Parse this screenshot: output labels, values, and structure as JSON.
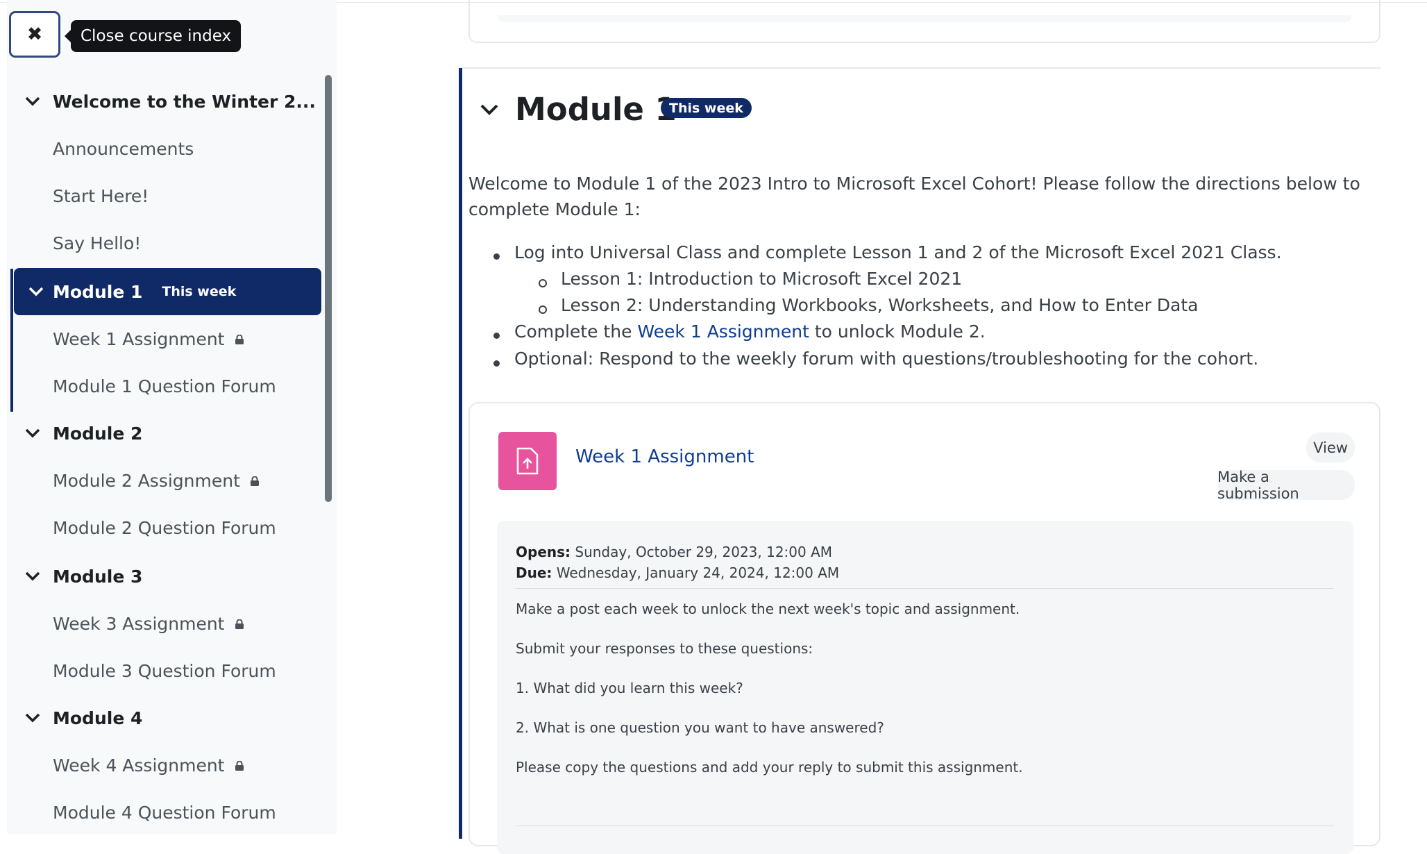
{
  "sidebar": {
    "close_icon": "close-icon",
    "tooltip": "Close course index",
    "sections": [
      {
        "title": "Welcome to the Winter 2...",
        "items": [
          "Announcements",
          "Start Here!",
          "Say Hello!"
        ]
      },
      {
        "title": "Module 1",
        "badge": "This week",
        "items": [
          "Week 1 Assignment",
          "Module 1 Question Forum"
        ]
      },
      {
        "title": "Module 2",
        "items": [
          "Module 2 Assignment",
          "Module 2 Question Forum"
        ]
      },
      {
        "title": "Module 3",
        "items": [
          "Week 3 Assignment",
          "Module 3 Question Forum"
        ]
      },
      {
        "title": "Module 4",
        "items": [
          "Week 4 Assignment",
          "Module 4 Question Forum"
        ]
      }
    ]
  },
  "main": {
    "section_title": "Module 1",
    "section_badge": "This week",
    "summary": "Welcome to Module 1 of the 2023 Intro to Microsoft Excel Cohort! Please follow the directions below to complete Module 1:",
    "bullets": {
      "b1": "Log into Universal Class and complete Lesson 1 and 2 of the Microsoft Excel 2021 Class.",
      "b1a": "Lesson 1: Introduction to Microsoft Excel 2021",
      "b1b": "Lesson 2: Understanding Workbooks, Worksheets, and How to Enter Data",
      "b2_pre": "Complete the ",
      "b2_link": "Week 1 Assignment",
      "b2_post": " to unlock Module 2.",
      "b3": "Optional: Respond to the weekly forum with questions/troubleshooting for the cohort."
    },
    "activity": {
      "icon": "assignment-upload-icon",
      "name": "Week 1 Assignment",
      "view_label": "View",
      "submission_label": "Make a submission",
      "opens_label": "Opens:",
      "opens_value": " Sunday, October 29, 2023, 12:00 AM",
      "due_label": "Due:",
      "due_value": " Wednesday, January 24, 2024, 12:00 AM",
      "description": [
        "Make a post each week to unlock the next week's topic and assignment.",
        "Submit your responses to these questions:",
        "1. What did you learn this week?",
        "2. What is one question you want to have answered?",
        "Please copy the questions and add your reply to submit this assignment."
      ]
    }
  },
  "colors": {
    "brand_navy": "#0f2a66",
    "link_blue": "#0f3d91",
    "assignment_pink": "#e7539c"
  }
}
